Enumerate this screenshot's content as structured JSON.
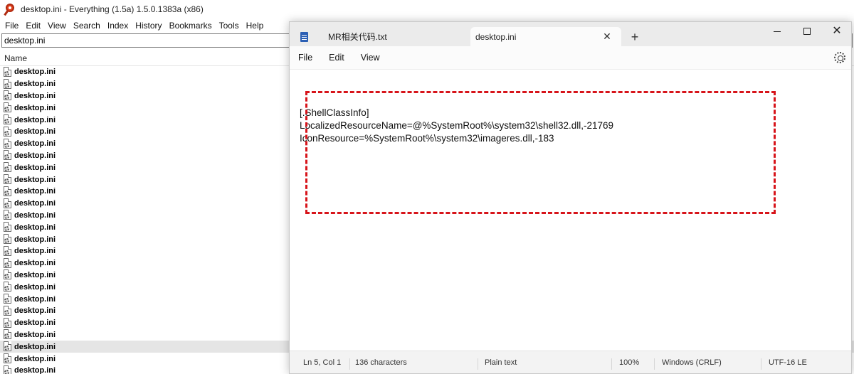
{
  "everything": {
    "title": "desktop.ini - Everything (1.5a) 1.5.0.1383a (x86)",
    "menu": [
      "File",
      "Edit",
      "View",
      "Search",
      "Index",
      "History",
      "Bookmarks",
      "Tools",
      "Help"
    ],
    "search_value": "desktop.ini",
    "column_name": "Name",
    "rows": [
      "desktop.ini",
      "desktop.ini",
      "desktop.ini",
      "desktop.ini",
      "desktop.ini",
      "desktop.ini",
      "desktop.ini",
      "desktop.ini",
      "desktop.ini",
      "desktop.ini",
      "desktop.ini",
      "desktop.ini",
      "desktop.ini",
      "desktop.ini",
      "desktop.ini",
      "desktop.ini",
      "desktop.ini",
      "desktop.ini",
      "desktop.ini",
      "desktop.ini",
      "desktop.ini",
      "desktop.ini",
      "desktop.ini",
      "desktop.ini",
      "desktop.ini",
      "desktop.ini"
    ],
    "selected_row_index": 23,
    "icons": {
      "app": "everything-search-icon",
      "file": "ini-settings-file-icon"
    }
  },
  "notepad": {
    "tabs": [
      {
        "label": "MR相关代码.txt",
        "active": false
      },
      {
        "label": "desktop.ini",
        "active": true
      }
    ],
    "new_tab_label": "+",
    "menu": [
      "File",
      "Edit",
      "View"
    ],
    "content_lines": [
      "",
      "[.ShellClassInfo]",
      "LocalizedResourceName=@%SystemRoot%\\system32\\shell32.dll,-21769",
      "IconResource=%SystemRoot%\\system32\\imageres.dll,-183"
    ],
    "highlight_color": "#d7141a",
    "status": {
      "position": "Ln 5, Col 1",
      "characters": "136 characters",
      "text_type": "Plain text",
      "zoom": "100%",
      "line_endings": "Windows (CRLF)",
      "encoding": "UTF-16 LE"
    },
    "icons": {
      "settings": "gear-icon",
      "close": "close-icon",
      "minimize": "minimize-icon",
      "maximize": "maximize-icon",
      "tab_file": "notepad-document-icon"
    }
  }
}
